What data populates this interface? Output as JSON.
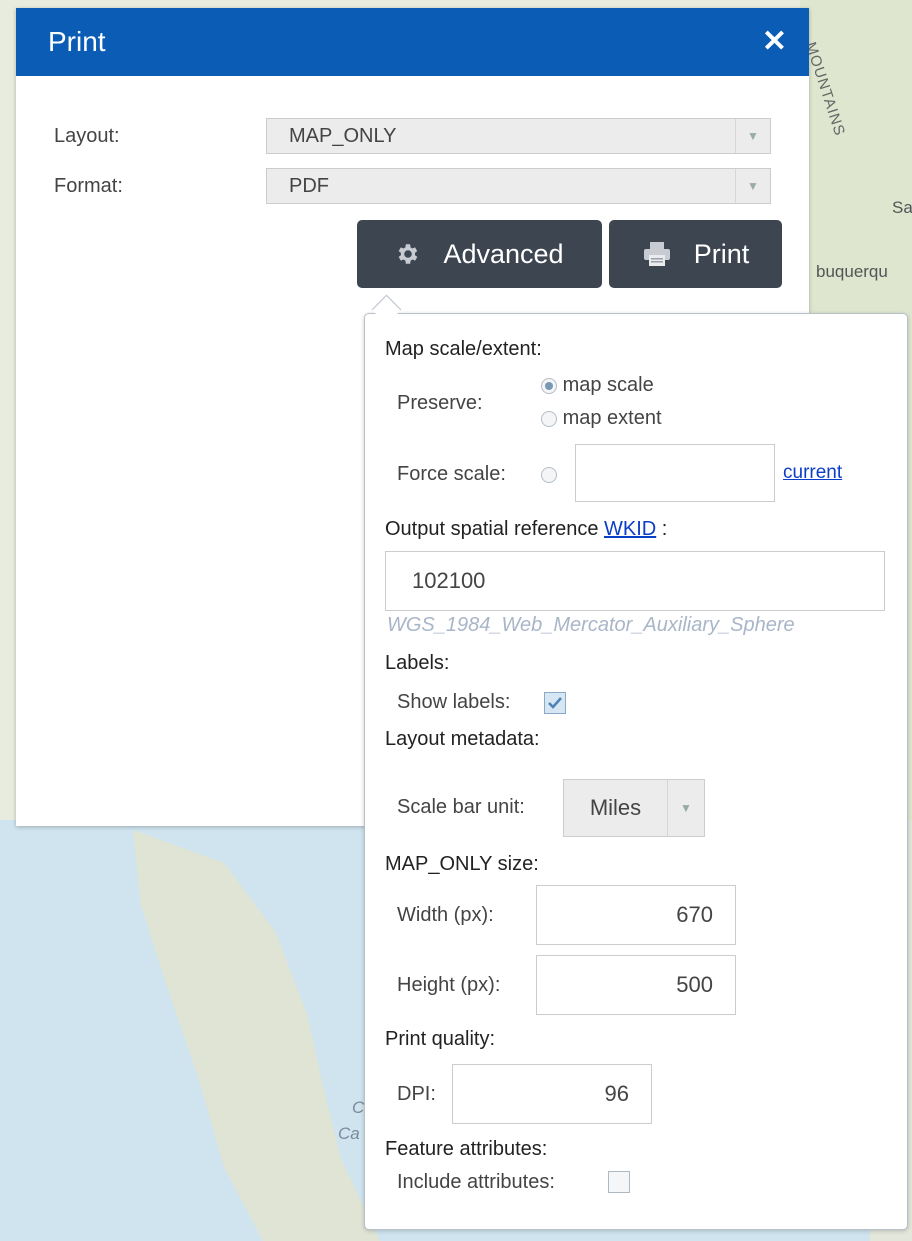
{
  "panel": {
    "title": "Print",
    "close_icon": "close-icon",
    "layout_label": "Layout:",
    "layout_value": "MAP_ONLY",
    "format_label": "Format:",
    "format_value": "PDF",
    "advanced_label": "Advanced",
    "print_label": "Print",
    "header_color": "#0b5cb4",
    "button_color": "#3d4551"
  },
  "advanced": {
    "map_scale_title": "Map scale/extent:",
    "preserve_label": "Preserve:",
    "preserve_options": [
      "map scale",
      "map extent"
    ],
    "preserve_selected": "map scale",
    "force_scale_label": "Force scale:",
    "force_scale_value": "",
    "current_link": "current",
    "spatial_ref_prefix": "Output spatial reference ",
    "wkid_link": "WKID",
    "spatial_ref_suffix": " :",
    "wkid_value": "102100",
    "wkid_name": "WGS_1984_Web_Mercator_Auxiliary_Sphere",
    "labels_title": "Labels:",
    "show_labels_label": "Show labels:",
    "show_labels_checked": true,
    "layout_metadata_title": "Layout metadata:",
    "scale_bar_unit_label": "Scale bar unit:",
    "scale_bar_unit_value": "Miles",
    "size_title": "MAP_ONLY size:",
    "width_label": "Width (px):",
    "width_value": "670",
    "height_label": "Height (px):",
    "height_value": "500",
    "print_quality_title": "Print quality:",
    "dpi_label": "DPI:",
    "dpi_value": "96",
    "feature_attr_title": "Feature attributes:",
    "include_attr_label": "Include attributes:",
    "include_attr_checked": false
  },
  "map": {
    "labels": [
      "MOUNTAINS",
      "Sa",
      "buquerqu",
      "C",
      "Ca"
    ]
  }
}
